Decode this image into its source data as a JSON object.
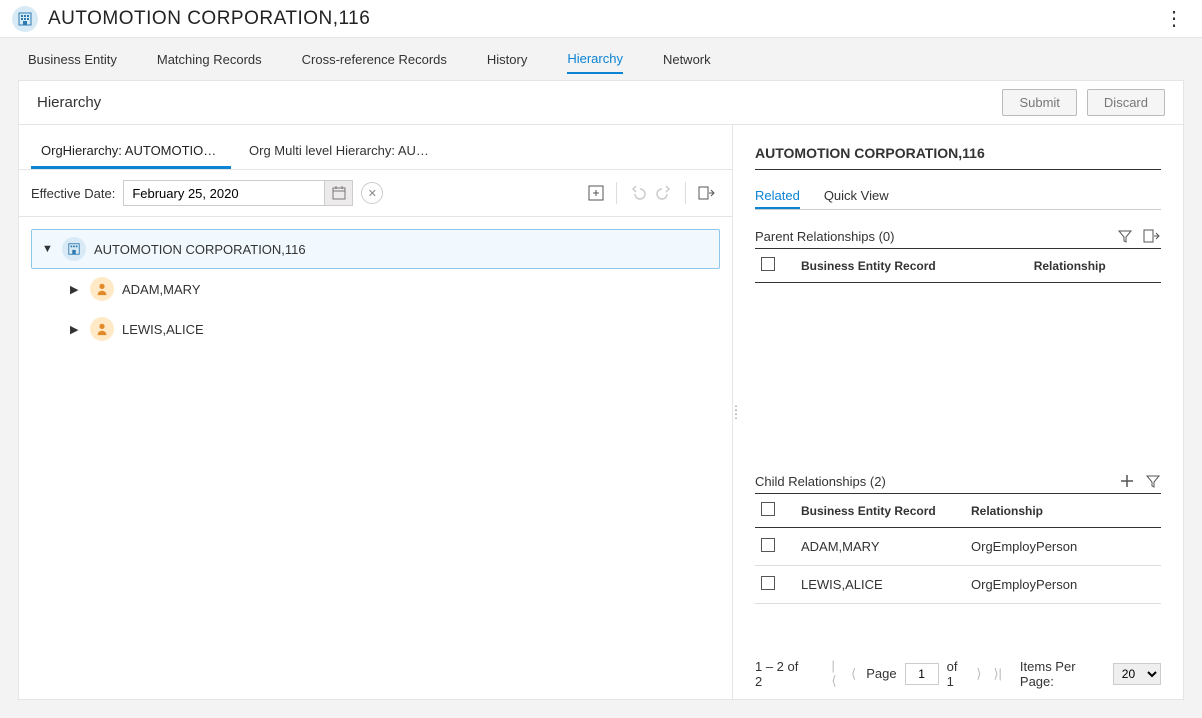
{
  "header": {
    "title": "AUTOMOTION CORPORATION,116"
  },
  "tabs": {
    "items": [
      "Business Entity",
      "Matching Records",
      "Cross-reference Records",
      "History",
      "Hierarchy",
      "Network"
    ],
    "active": 4
  },
  "page": {
    "title": "Hierarchy",
    "submit": "Submit",
    "discard": "Discard"
  },
  "subTabs": {
    "items": [
      "OrgHierarchy: AUTOMOTION CO...",
      "Org Multi level Hierarchy: AUTOM..."
    ],
    "active": 0
  },
  "toolbar": {
    "effectiveDateLabel": "Effective Date:",
    "effectiveDate": "February 25, 2020"
  },
  "tree": {
    "root": {
      "label": "AUTOMOTION CORPORATION,116"
    },
    "children": [
      {
        "label": "ADAM,MARY"
      },
      {
        "label": "LEWIS,ALICE"
      }
    ]
  },
  "details": {
    "entityTitle": "AUTOMOTION CORPORATION,116",
    "tabs": {
      "related": "Related",
      "quickView": "Quick View"
    },
    "parent": {
      "title": "Parent Relationships (0)",
      "cols": {
        "record": "Business Entity Record",
        "rel": "Relationship"
      }
    },
    "child": {
      "title": "Child Relationships (2)",
      "cols": {
        "record": "Business Entity Record",
        "rel": "Relationship"
      },
      "rows": [
        {
          "record": "ADAM,MARY",
          "rel": "OrgEmployPerson"
        },
        {
          "record": "LEWIS,ALICE",
          "rel": "OrgEmployPerson"
        }
      ]
    },
    "pager": {
      "range": "1 – 2 of 2",
      "pageLabel": "Page",
      "page": "1",
      "ofLabel": "of 1",
      "ippLabel": "Items Per Page:",
      "ipp": "20"
    }
  }
}
